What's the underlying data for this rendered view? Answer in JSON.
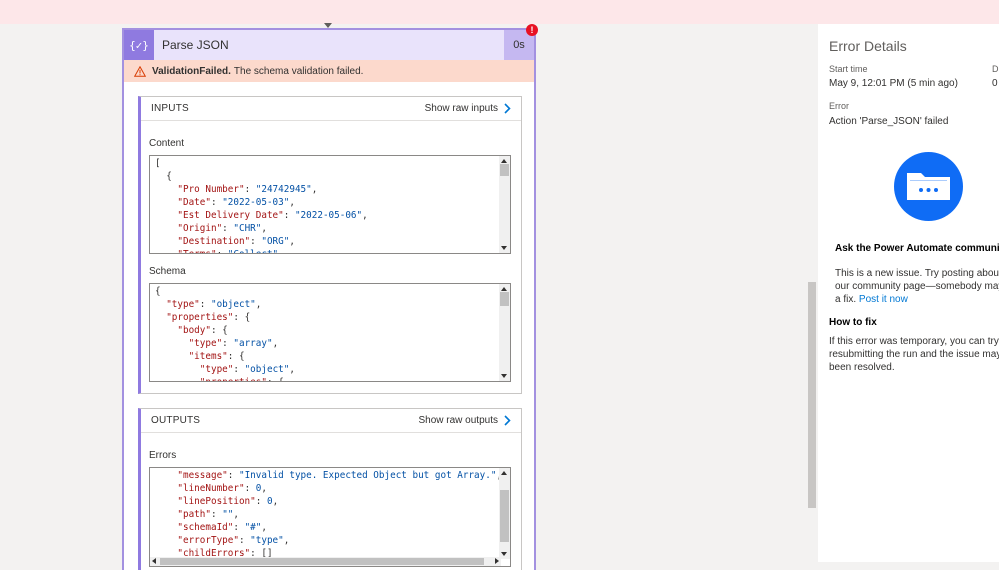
{
  "action": {
    "icon_glyph": "{✓}",
    "title": "Parse JSON",
    "duration": "0s",
    "error_badge": "!",
    "validation_code": "ValidationFailed.",
    "validation_message": "The schema validation failed."
  },
  "inputs": {
    "header": "INPUTS",
    "raw_link": "Show raw inputs",
    "content_label": "Content",
    "schema_label": "Schema"
  },
  "outputs": {
    "header": "OUTPUTS",
    "raw_link": "Show raw outputs",
    "errors_label": "Errors"
  },
  "content_json": [
    [
      {
        "t": "p",
        "v": "["
      }
    ],
    [
      {
        "t": "p",
        "v": "  {"
      }
    ],
    [
      {
        "t": "k",
        "v": "    \"Pro Number\""
      },
      {
        "t": "p",
        "v": ": "
      },
      {
        "t": "s",
        "v": "\"24742945\""
      },
      {
        "t": "p",
        "v": ","
      }
    ],
    [
      {
        "t": "k",
        "v": "    \"Date\""
      },
      {
        "t": "p",
        "v": ": "
      },
      {
        "t": "s",
        "v": "\"2022-05-03\""
      },
      {
        "t": "p",
        "v": ","
      }
    ],
    [
      {
        "t": "k",
        "v": "    \"Est Delivery Date\""
      },
      {
        "t": "p",
        "v": ": "
      },
      {
        "t": "s",
        "v": "\"2022-05-06\""
      },
      {
        "t": "p",
        "v": ","
      }
    ],
    [
      {
        "t": "k",
        "v": "    \"Origin\""
      },
      {
        "t": "p",
        "v": ": "
      },
      {
        "t": "s",
        "v": "\"CHR\""
      },
      {
        "t": "p",
        "v": ","
      }
    ],
    [
      {
        "t": "k",
        "v": "    \"Destination\""
      },
      {
        "t": "p",
        "v": ": "
      },
      {
        "t": "s",
        "v": "\"ORG\""
      },
      {
        "t": "p",
        "v": ","
      }
    ],
    [
      {
        "t": "k",
        "v": "    \"Terms\""
      },
      {
        "t": "p",
        "v": ": "
      },
      {
        "t": "s",
        "v": "\"Collect\""
      }
    ]
  ],
  "schema_json": [
    [
      {
        "t": "p",
        "v": "{"
      }
    ],
    [
      {
        "t": "k",
        "v": "  \"type\""
      },
      {
        "t": "p",
        "v": ": "
      },
      {
        "t": "s",
        "v": "\"object\""
      },
      {
        "t": "p",
        "v": ","
      }
    ],
    [
      {
        "t": "k",
        "v": "  \"properties\""
      },
      {
        "t": "p",
        "v": ": {"
      }
    ],
    [
      {
        "t": "k",
        "v": "    \"body\""
      },
      {
        "t": "p",
        "v": ": {"
      }
    ],
    [
      {
        "t": "k",
        "v": "      \"type\""
      },
      {
        "t": "p",
        "v": ": "
      },
      {
        "t": "s",
        "v": "\"array\""
      },
      {
        "t": "p",
        "v": ","
      }
    ],
    [
      {
        "t": "k",
        "v": "      \"items\""
      },
      {
        "t": "p",
        "v": ": {"
      }
    ],
    [
      {
        "t": "k",
        "v": "        \"type\""
      },
      {
        "t": "p",
        "v": ": "
      },
      {
        "t": "s",
        "v": "\"object\""
      },
      {
        "t": "p",
        "v": ","
      }
    ],
    [
      {
        "t": "k",
        "v": "        \"properties\""
      },
      {
        "t": "p",
        "v": ": {"
      }
    ]
  ],
  "errors_json": [
    [
      {
        "t": "k",
        "v": "    \"message\""
      },
      {
        "t": "p",
        "v": ": "
      },
      {
        "t": "s",
        "v": "\"Invalid type. Expected Object but got Array.\""
      },
      {
        "t": "p",
        "v": ","
      }
    ],
    [
      {
        "t": "k",
        "v": "    \"lineNumber\""
      },
      {
        "t": "p",
        "v": ": "
      },
      {
        "t": "s",
        "v": "0"
      },
      {
        "t": "p",
        "v": ","
      }
    ],
    [
      {
        "t": "k",
        "v": "    \"linePosition\""
      },
      {
        "t": "p",
        "v": ": "
      },
      {
        "t": "s",
        "v": "0"
      },
      {
        "t": "p",
        "v": ","
      }
    ],
    [
      {
        "t": "k",
        "v": "    \"path\""
      },
      {
        "t": "p",
        "v": ": "
      },
      {
        "t": "s",
        "v": "\"\""
      },
      {
        "t": "p",
        "v": ","
      }
    ],
    [
      {
        "t": "k",
        "v": "    \"schemaId\""
      },
      {
        "t": "p",
        "v": ": "
      },
      {
        "t": "s",
        "v": "\"#\""
      },
      {
        "t": "p",
        "v": ","
      }
    ],
    [
      {
        "t": "k",
        "v": "    \"errorType\""
      },
      {
        "t": "p",
        "v": ": "
      },
      {
        "t": "s",
        "v": "\"type\""
      },
      {
        "t": "p",
        "v": ","
      }
    ],
    [
      {
        "t": "k",
        "v": "    \"childErrors\""
      },
      {
        "t": "p",
        "v": ": []"
      }
    ]
  ],
  "details": {
    "title": "Error Details",
    "start_label": "Start time",
    "start_value": "May 9, 12:01 PM (5 min ago)",
    "duration_label": "D",
    "duration_value": "0",
    "error_label": "Error",
    "error_value": "Action 'Parse_JSON' failed",
    "community_heading": "Ask the Power Automate community",
    "community_line1": "This is a new issue. Try posting about it",
    "community_line2": "our community page—somebody may",
    "community_line3_prefix": "a fix.",
    "post_link": "Post it now",
    "howto_heading": "How to fix",
    "howto_line1": "If this error was temporary, you can try",
    "howto_line2": "resubmitting the run and the issue may",
    "howto_line3": "been resolved."
  },
  "colors": {
    "accent_purple": "#8f7ae0",
    "error_red": "#e81123",
    "warning_bg": "#fcd9cc",
    "link_blue": "#0078d4",
    "folder_blue": "#0f6cf5"
  }
}
